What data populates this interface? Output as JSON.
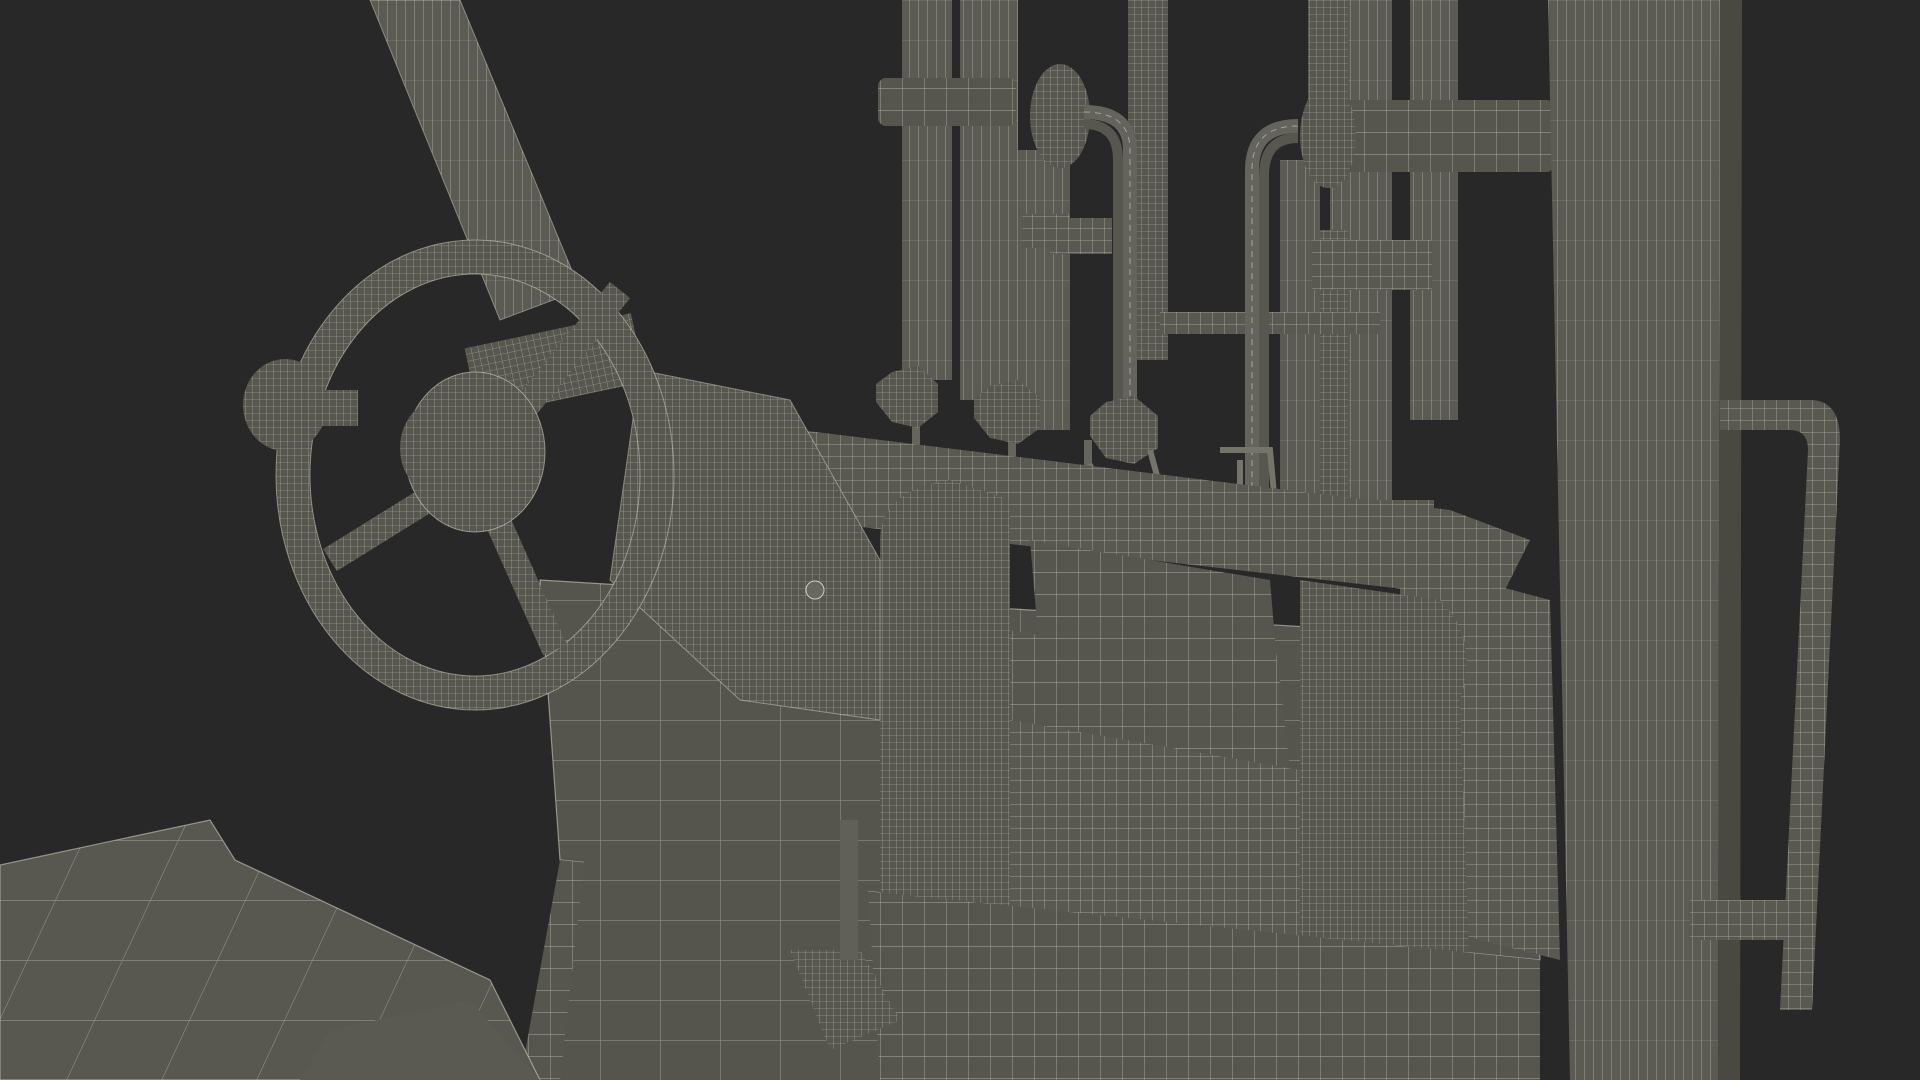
{
  "scene": {
    "subject": "forklift-cab-wireframe",
    "colors": {
      "background": "#2b2b2b",
      "surface": "#5e5e56",
      "surface_light": "#75756b",
      "surface_dark": "#48483f",
      "wire": "#d9d9c9"
    }
  }
}
